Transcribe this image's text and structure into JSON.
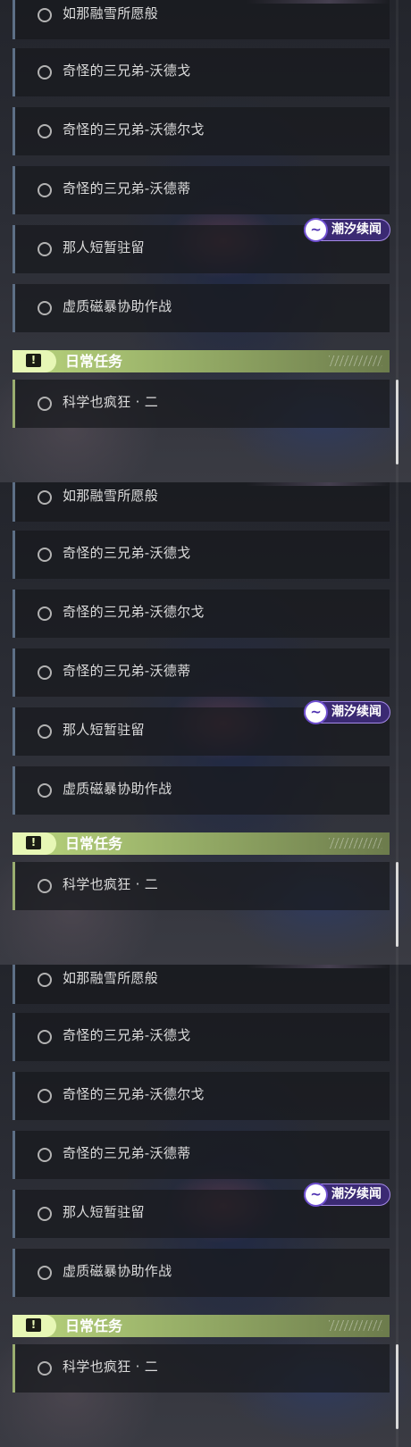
{
  "tasks": [
    {
      "label": "如那融雪所愿般"
    },
    {
      "label": "奇怪的三兄弟-沃德戈"
    },
    {
      "label": "奇怪的三兄弟-沃德尔戈"
    },
    {
      "label": "奇怪的三兄弟-沃德蒂"
    },
    {
      "label": "那人短暂驻留"
    },
    {
      "label": "虚质磁暴协助作战"
    }
  ],
  "event_badge": {
    "label": "潮汐续闻",
    "icon": "wave-emblem-icon"
  },
  "daily_section": {
    "title": "日常任务",
    "icon": "exclamation-icon",
    "items": [
      {
        "label": "科学也疯狂 · 二"
      }
    ]
  },
  "colors": {
    "daily_accent": "#b9d47d",
    "event_accent": "#7a5ad8",
    "main_quest_border": "#5d6f86"
  }
}
